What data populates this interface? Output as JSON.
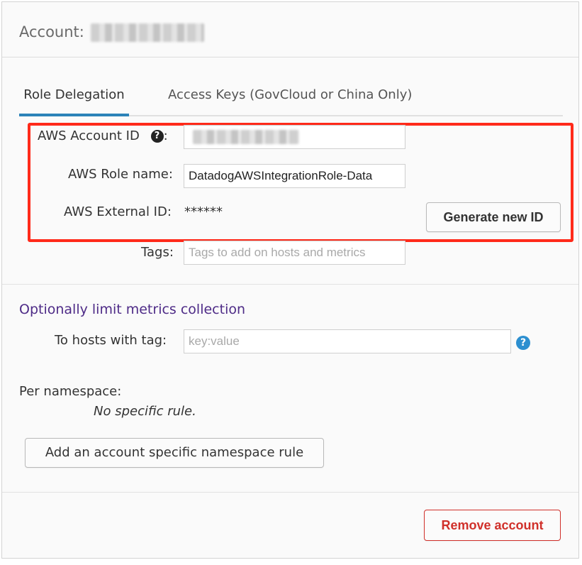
{
  "header": {
    "account_label": "Account:"
  },
  "tabs": [
    {
      "label": "Role Delegation",
      "active": true
    },
    {
      "label": "Access Keys (GovCloud or China Only)",
      "active": false
    }
  ],
  "form": {
    "account_id_label": "AWS Account ID",
    "account_id_suffix": ":",
    "help_glyph": "?",
    "role_name_label": "AWS Role name:",
    "role_name_value": "DatadogAWSIntegrationRole-Data",
    "external_id_label": "AWS External ID:",
    "external_id_value": "******",
    "generate_button": "Generate new ID",
    "tags_label": "Tags:",
    "tags_placeholder": "Tags to add on hosts and metrics"
  },
  "limits": {
    "title": "Optionally limit metrics collection",
    "hosts_label": "To hosts with tag:",
    "hosts_placeholder": "key:value",
    "namespace_label": "Per namespace:",
    "no_rule_text": "No specific rule.",
    "add_rule_button": "Add an account specific namespace rule"
  },
  "footer": {
    "remove_button": "Remove account"
  },
  "colors": {
    "tab_underline": "#2c83b8",
    "highlight_border": "#ff2a1a",
    "section_title": "#4e2b87",
    "danger": "#d0302a",
    "help_icon": "#2c8fd0"
  },
  "icons": {
    "account_id_help": "question-circle-icon",
    "hosts_tag_help": "question-circle-icon"
  }
}
